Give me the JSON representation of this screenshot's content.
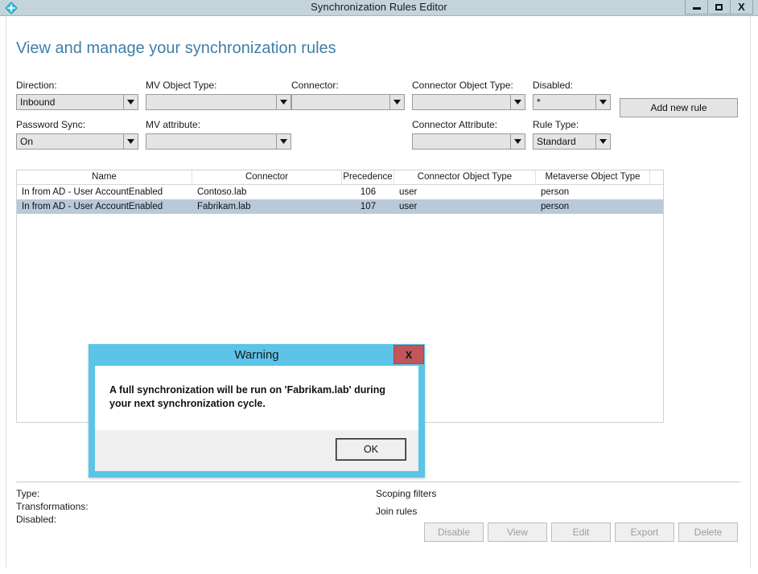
{
  "window": {
    "title": "Synchronization Rules Editor",
    "icon": "sync-diamond-icon",
    "minimize_label": "–",
    "maximize_label": "□",
    "close_label": "X"
  },
  "page": {
    "heading": "View and manage your synchronization rules",
    "heading_color": "#3f7fa8"
  },
  "filters": {
    "direction": {
      "label": "Direction:",
      "value": "Inbound"
    },
    "mv_object_type": {
      "label": "MV Object Type:",
      "value": ""
    },
    "connector": {
      "label": "Connector:",
      "value": ""
    },
    "connector_object_type": {
      "label": "Connector Object Type:",
      "value": ""
    },
    "disabled": {
      "label": "Disabled:",
      "value": "*"
    },
    "password_sync": {
      "label": "Password Sync:",
      "value": "On"
    },
    "mv_attribute": {
      "label": "MV attribute:",
      "value": ""
    },
    "connector_attribute": {
      "label": "Connector Attribute:",
      "value": ""
    },
    "rule_type": {
      "label": "Rule Type:",
      "value": "Standard"
    },
    "add_new_rule_label": "Add new rule"
  },
  "table": {
    "columns": [
      "Name",
      "Connector",
      "Precedence",
      "Connector Object Type",
      "Metaverse Object Type"
    ],
    "rows": [
      {
        "name": "In from AD - User AccountEnabled",
        "connector": "Contoso.lab",
        "precedence": "106",
        "connector_object_type": "user",
        "metaverse_object_type": "person",
        "selected": false
      },
      {
        "name": "In from AD - User AccountEnabled",
        "connector": "Fabrikam.lab",
        "precedence": "107",
        "connector_object_type": "user",
        "metaverse_object_type": "person",
        "selected": true
      }
    ],
    "selection_color": "#b8c9da"
  },
  "detail": {
    "type_label": "Type:",
    "transformations_label": "Transformations:",
    "disabled_label": "Disabled:",
    "scoping_filters_label": "Scoping filters",
    "join_rules_label": "Join rules"
  },
  "footer": {
    "buttons": [
      {
        "label": "Disable",
        "disabled": true
      },
      {
        "label": "View",
        "disabled": true
      },
      {
        "label": "Edit",
        "disabled": true
      },
      {
        "label": "Export",
        "disabled": true
      },
      {
        "label": "Delete",
        "disabled": true
      }
    ]
  },
  "dialog": {
    "title": "Warning",
    "close_label": "X",
    "message": "A full synchronization will be run on 'Fabrikam.lab' during your next synchronization cycle.",
    "ok_label": "OK",
    "border_color": "#5bc4e8",
    "close_color": "#c2565a"
  }
}
